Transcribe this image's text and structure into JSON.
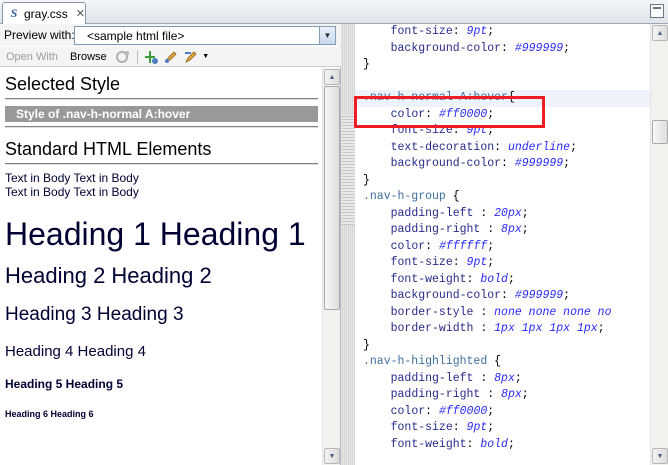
{
  "editor": {
    "tab_label": "gray.css",
    "tab_icon": "S",
    "tab_close": "✕"
  },
  "preview": {
    "label": "Preview with:",
    "selected_file": "<sample html file>",
    "open_with": "Open With",
    "browse": "Browse"
  },
  "content": {
    "selected_style_title": "Selected Style",
    "selected_style_box": "Style of .nav-h-normal A:hover",
    "standard_title": "Standard HTML Elements",
    "body_line1": "Text in Body Text in Body",
    "body_line2": "Text in Body Text in Body",
    "h1": "Heading 1 Heading 1",
    "h2": "Heading 2 Heading 2",
    "h3": "Heading 3 Heading 3",
    "h4": "Heading 4 Heading 4",
    "h5": "Heading 5 Heading 5",
    "h6": "Heading 6 Heading 6"
  },
  "colors": {
    "highlight_border": "#ee1c24",
    "selected_style_bg": "#999999",
    "heading_text": "#000033"
  },
  "code_lines": [
    {
      "t": "    font-size: 9pt;"
    },
    {
      "t": "    background-color: #999999;"
    },
    {
      "t": "}"
    },
    {
      "t": ""
    },
    {
      "t": ".nav-h-normal A:hover{"
    },
    {
      "t": "    color: #ff0000;"
    },
    {
      "t": "    font-size: 9pt;"
    },
    {
      "t": "    text-decoration: underline;"
    },
    {
      "t": "    background-color: #999999;"
    },
    {
      "t": "}"
    },
    {
      "t": ".nav-h-group {"
    },
    {
      "t": "    padding-left : 20px;"
    },
    {
      "t": "    padding-right : 8px;"
    },
    {
      "t": "    color: #ffffff;"
    },
    {
      "t": "    font-size: 9pt;"
    },
    {
      "t": "    font-weight: bold;"
    },
    {
      "t": "    background-color: #999999;"
    },
    {
      "t": "    border-style : none none none no"
    },
    {
      "t": "    border-width : 1px 1px 1px 1px;"
    },
    {
      "t": "}"
    },
    {
      "t": ".nav-h-highlighted {"
    },
    {
      "t": "    padding-left : 8px;"
    },
    {
      "t": "    padding-right : 8px;"
    },
    {
      "t": "    color: #ff0000;"
    },
    {
      "t": "    font-size: 9pt;"
    },
    {
      "t": "    font-weight: bold;"
    }
  ]
}
